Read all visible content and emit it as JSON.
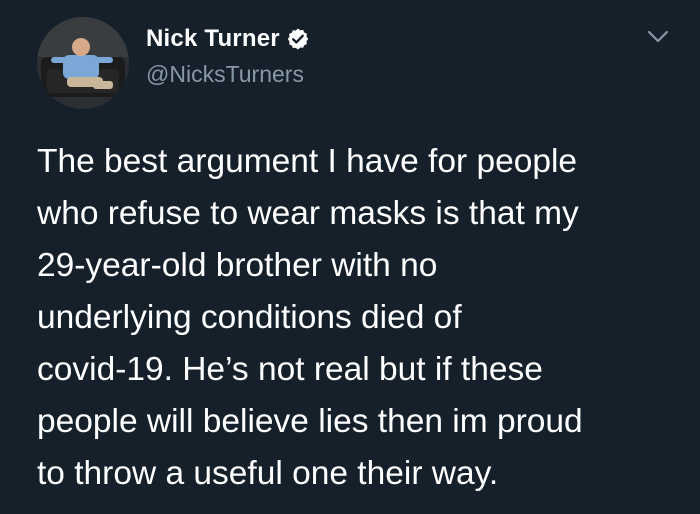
{
  "author": {
    "display_name": "Nick Turner",
    "handle": "@NicksTurners",
    "verified": true,
    "avatar_icon": "profile-photo-man-on-couch"
  },
  "tweet": {
    "lines": [
      "The best argument I have for people",
      "who refuse to wear masks is that my",
      "29-year-old brother with no",
      "underlying conditions died of",
      "covid-19. He’s not real but if these",
      "people will believe lies then im proud",
      "to throw a useful one their way."
    ]
  },
  "icons": {
    "verified": "verified-badge-icon",
    "menu": "chevron-down-icon"
  },
  "colors": {
    "background": "#15202b",
    "text": "#ffffff",
    "secondary_text": "#8899a6",
    "verified_badge": "#ffffff"
  }
}
